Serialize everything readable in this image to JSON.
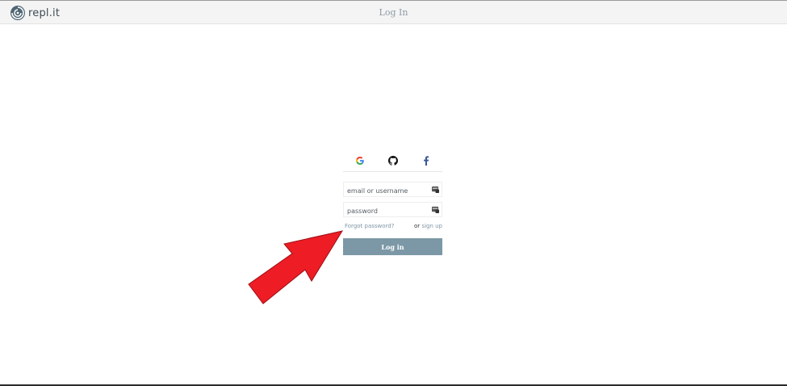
{
  "brand": {
    "name": "repl.it",
    "icon": "replit-logo-icon"
  },
  "header": {
    "title": "Log In"
  },
  "oauth": [
    {
      "name": "google",
      "icon": "google-icon"
    },
    {
      "name": "github",
      "icon": "github-icon"
    },
    {
      "name": "facebook",
      "icon": "facebook-icon"
    }
  ],
  "form": {
    "email_placeholder": "email or username",
    "email_value": "",
    "password_placeholder": "password",
    "password_value": "",
    "forgot_label": "Forgot password?",
    "or_label": "or",
    "signup_label": "sign up",
    "login_label": "Log in"
  },
  "annotation": {
    "arrow_icon": "red-arrow-icon",
    "arrow_color": "#ee1c24"
  },
  "colors": {
    "button_bg": "#7c98a6",
    "link": "#7e96a5"
  }
}
